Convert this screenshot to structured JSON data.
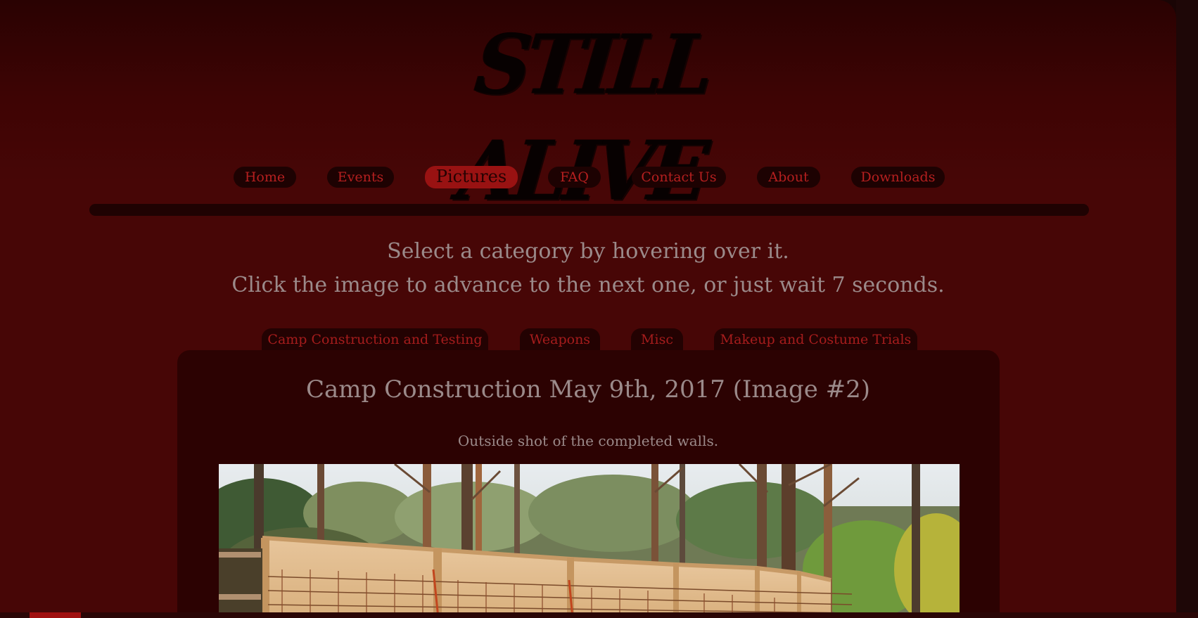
{
  "logo": {
    "text": "STILL ALIVE"
  },
  "nav": {
    "items": [
      {
        "label": "Home"
      },
      {
        "label": "Events"
      },
      {
        "label": "Pictures"
      },
      {
        "label": "FAQ"
      },
      {
        "label": "Contact Us"
      },
      {
        "label": "About"
      },
      {
        "label": "Downloads"
      }
    ],
    "active": "Pictures"
  },
  "instructions": {
    "line1": "Select a category by hovering over it.",
    "line2": "Click the image to advance to the next one, or just wait 7 seconds."
  },
  "categories": [
    {
      "label": "Camp Construction and Testing"
    },
    {
      "label": "Weapons"
    },
    {
      "label": "Misc"
    },
    {
      "label": "Makeup and Costume Trials"
    }
  ],
  "gallery": {
    "title": "Camp Construction May 9th, 2017 (Image #2)",
    "caption": "Outside shot of the completed walls."
  },
  "colors": {
    "background": "#470606",
    "nav_active": "#991212",
    "nav_text": "#b51f1f",
    "body_text": "#9b8a8a"
  }
}
